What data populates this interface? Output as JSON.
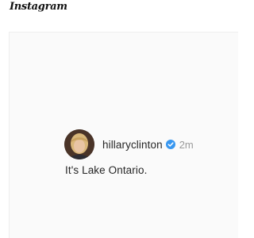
{
  "app": {
    "name": "Instagram"
  },
  "post": {
    "username": "hillaryclinton",
    "verified": true,
    "timestamp": "2m",
    "caption": "It's Lake Ontario."
  },
  "icons": {
    "avatar": "profile-photo",
    "verified": "verified-badge-icon"
  },
  "colors": {
    "verified_badge": "#3897f0",
    "card_background": "#fafafa",
    "timestamp": "#9a9a9a",
    "text": "#262626"
  }
}
